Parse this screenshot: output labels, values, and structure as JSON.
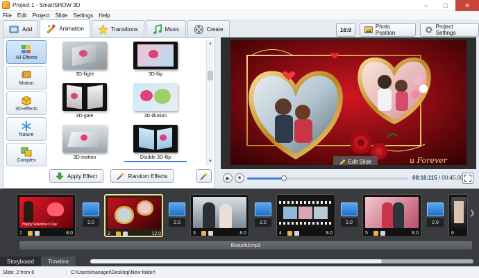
{
  "window": {
    "title": "Project 1 - SmartSHOW 3D"
  },
  "menu": [
    "File",
    "Edit",
    "Project",
    "Slide",
    "Settings",
    "Help"
  ],
  "tabs": [
    {
      "id": "add",
      "label": "Add",
      "icon": "add-icon",
      "active": false
    },
    {
      "id": "animation",
      "label": "Animation",
      "icon": "animation-icon",
      "active": true
    },
    {
      "id": "transitions",
      "label": "Transitions",
      "icon": "star-icon",
      "active": false
    },
    {
      "id": "music",
      "label": "Music",
      "icon": "music-note-icon",
      "active": false
    },
    {
      "id": "create",
      "label": "Create",
      "icon": "film-reel-icon",
      "active": false
    }
  ],
  "toolbar": {
    "aspect_ratio": "16:9",
    "photo_position": "Photo Position",
    "project_settings": "Project Settings"
  },
  "categories": [
    {
      "label": "All Effects",
      "active": true,
      "icon": "puzzle-icon"
    },
    {
      "label": "Motion",
      "active": false,
      "icon": "motion-icon"
    },
    {
      "label": "3D-effects",
      "active": false,
      "icon": "cube-icon"
    },
    {
      "label": "Nature",
      "active": false,
      "icon": "snowflake-icon"
    },
    {
      "label": "Complex",
      "active": false,
      "icon": "complex-icon"
    }
  ],
  "effects": [
    {
      "label": "3D-flight",
      "selected": false
    },
    {
      "label": "3D-flip",
      "selected": false
    },
    {
      "label": "3D-gate",
      "selected": false
    },
    {
      "label": "3D-illusion",
      "selected": false
    },
    {
      "label": "3D-motion",
      "selected": false
    },
    {
      "label": "Double 3D-flip",
      "selected": true
    }
  ],
  "buttons": {
    "apply_effect": "Apply Effect",
    "random_effects": "Random Effects"
  },
  "preview": {
    "edit_slide": "Edit Slide",
    "caption": "u Forever"
  },
  "playback": {
    "current": "00:10.115",
    "separator": " / ",
    "total": "00:45.000",
    "progress": 0.23
  },
  "slides": [
    {
      "num": "1",
      "duration": "8.0",
      "caption": "Happy Valentine's Day"
    },
    {
      "num": "2",
      "duration": "12.0",
      "selected": true
    },
    {
      "num": "3",
      "duration": "8.0"
    },
    {
      "num": "4",
      "duration": "9.0"
    },
    {
      "num": "5",
      "duration": "8.0"
    },
    {
      "num": "6",
      "duration": ""
    }
  ],
  "transitions": [
    "2.0",
    "2.0",
    "2.0",
    "2.0",
    "2.0"
  ],
  "music_track": "Beautiful.mp3",
  "storyboard_tabs": [
    {
      "label": "Storyboard",
      "active": true
    },
    {
      "label": "Timeline",
      "active": false
    }
  ],
  "status": {
    "slide": "Slide: 2 from 6",
    "path": "C:\\Users\\manager\\Desktop\\New folder\\"
  },
  "colors": {
    "accent": "#3b7fd6",
    "selected_slide": "#f1e08a",
    "storyboard_bg": "#393b3e"
  }
}
